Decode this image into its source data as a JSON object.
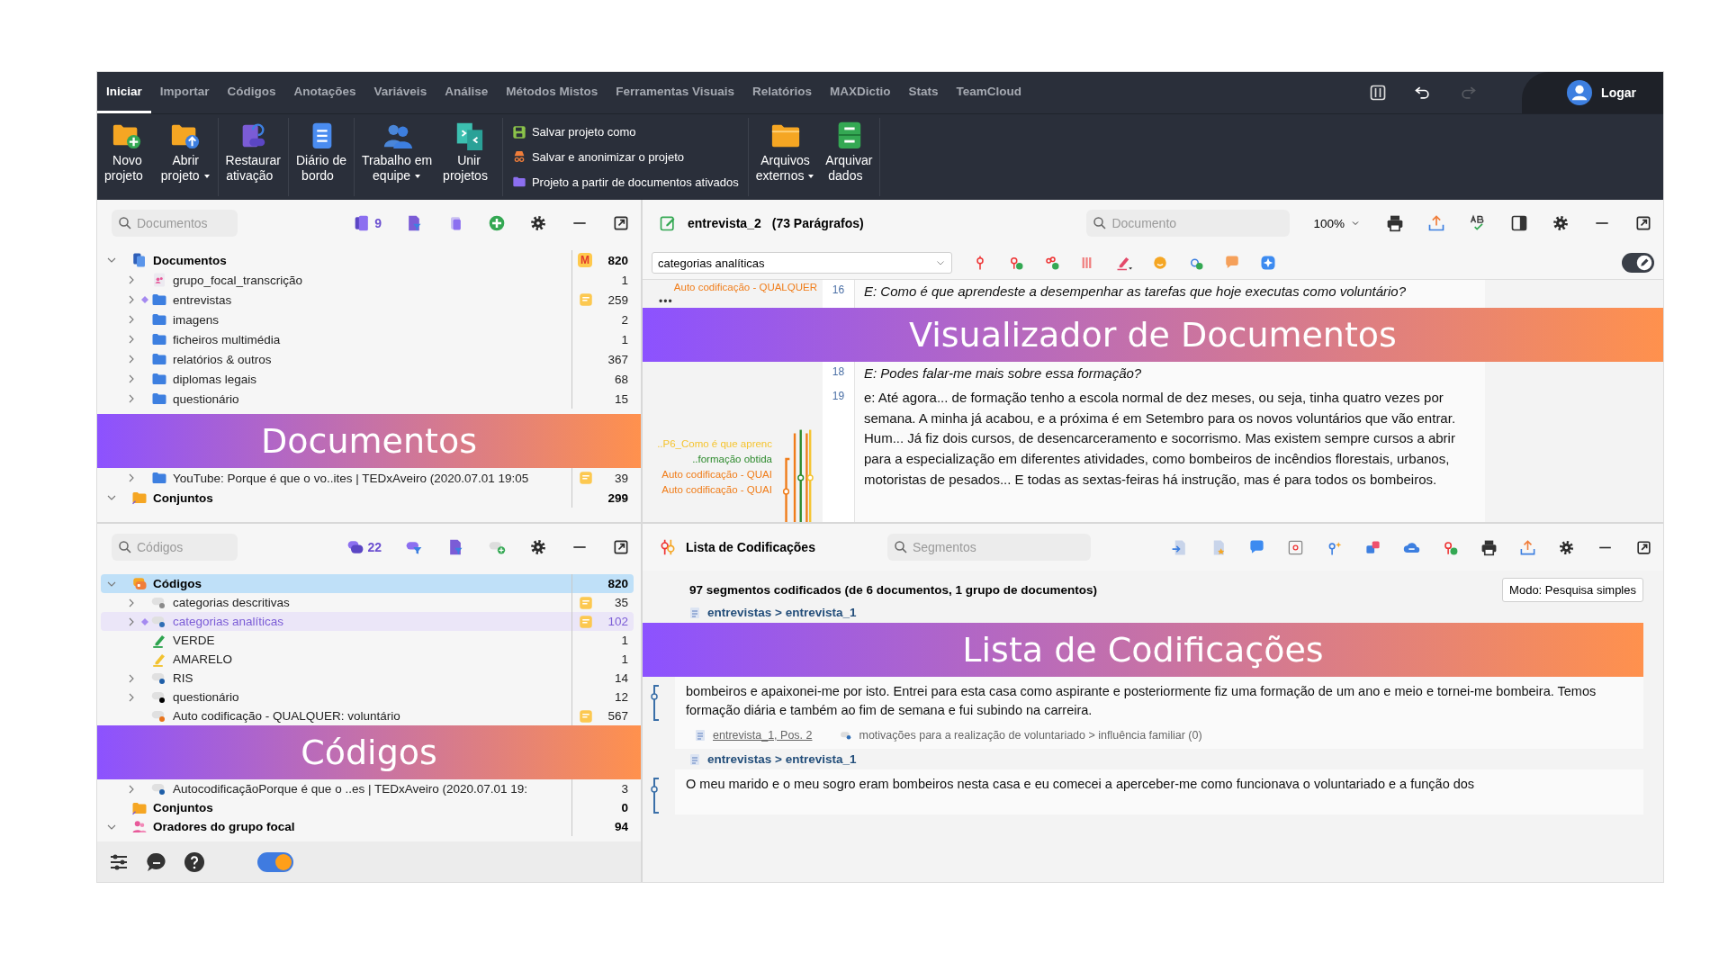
{
  "menu": {
    "tabs": [
      {
        "label": "Iniciar",
        "selected": true
      },
      {
        "label": "Importar",
        "selected": false
      },
      {
        "label": "Códigos",
        "selected": false
      },
      {
        "label": "Anotações",
        "selected": false
      },
      {
        "label": "Variáveis",
        "selected": false
      },
      {
        "label": "Análise",
        "selected": false
      },
      {
        "label": "Métodos Mistos",
        "selected": false
      },
      {
        "label": "Ferramentas Visuais",
        "selected": false
      },
      {
        "label": "Relatórios",
        "selected": false
      },
      {
        "label": "MAXDictio",
        "selected": false
      },
      {
        "label": "Stats",
        "selected": false
      },
      {
        "label": "TeamCloud",
        "selected": false
      }
    ],
    "redo_disabled": true,
    "login": "Logar"
  },
  "ribbon": [
    {
      "kind": "buttons",
      "items": [
        {
          "label": "Novo\nprojeto",
          "dropdown": false
        },
        {
          "label": "Abrir\nprojeto",
          "dropdown": true
        }
      ]
    },
    {
      "kind": "buttons",
      "items": [
        {
          "label": "Restaurar\nativação",
          "dropdown": false
        }
      ]
    },
    {
      "kind": "buttons",
      "items": [
        {
          "label": "Diário de\nbordo",
          "dropdown": false
        }
      ]
    },
    {
      "kind": "buttons",
      "items": [
        {
          "label": "Trabalho em\nequipe",
          "dropdown": true
        },
        {
          "label": "Unir\nprojetos",
          "dropdown": false
        }
      ]
    },
    {
      "kind": "links",
      "items": [
        {
          "label": "Salvar projeto como"
        },
        {
          "label": "Salvar e anonimizar o projeto"
        },
        {
          "label": "Projeto a partir de documentos ativados"
        }
      ]
    },
    {
      "kind": "buttons",
      "items": [
        {
          "label": "Arquivos\nexternos",
          "dropdown": true
        },
        {
          "label": "Arquivar\ndados",
          "dropdown": false
        }
      ]
    }
  ],
  "docs_panel": {
    "search": {
      "placeholder": "Documentos"
    },
    "counter": "9",
    "tree": [
      {
        "kind": "root-docs",
        "label": "Documentos",
        "expandable": true,
        "expanded": true,
        "selected": false,
        "activated": false,
        "memo": false,
        "badge": "M",
        "count": "820",
        "children": [
          {
            "kind": "focus-group",
            "label": "grupo_focal_transcrição",
            "expandable": true,
            "expanded": false,
            "selected": false,
            "activated": false,
            "memo": false,
            "count": "1"
          },
          {
            "kind": "folder",
            "label": "entrevistas",
            "expandable": true,
            "expanded": false,
            "selected": false,
            "activated": true,
            "memo": true,
            "count": "259"
          },
          {
            "kind": "folder",
            "label": "imagens",
            "expandable": true,
            "expanded": false,
            "selected": false,
            "activated": false,
            "memo": false,
            "count": "2"
          },
          {
            "kind": "folder",
            "label": "ficheiros multimédia",
            "expandable": true,
            "expanded": false,
            "selected": false,
            "activated": false,
            "memo": false,
            "count": "1"
          },
          {
            "kind": "folder",
            "label": "relatórios & outros",
            "expandable": true,
            "expanded": false,
            "selected": false,
            "activated": false,
            "memo": false,
            "count": "367"
          },
          {
            "kind": "folder",
            "label": "diplomas legais",
            "expandable": true,
            "expanded": false,
            "selected": false,
            "activated": false,
            "memo": false,
            "count": "68"
          },
          {
            "kind": "folder",
            "label": "questionário",
            "expandable": true,
            "expanded": false,
            "selected": false,
            "activated": false,
            "memo": false,
            "count": "15"
          },
          {
            "kind": "banner",
            "label": "Documentos"
          },
          {
            "kind": "folder",
            "label": "YouTube: Porque é que o vo..ites | TEDxAveiro (2020.07.01 19:05",
            "expandable": true,
            "expanded": false,
            "selected": false,
            "activated": false,
            "memo": true,
            "count": "39"
          }
        ]
      },
      {
        "kind": "set",
        "label": "Conjuntos",
        "expandable": true,
        "expanded": true,
        "selected": false,
        "activated": false,
        "memo": false,
        "count": "299"
      }
    ]
  },
  "codes_panel": {
    "search": {
      "placeholder": "Códigos"
    },
    "counter": "22",
    "tree": [
      {
        "kind": "root-codes",
        "label": "Códigos",
        "expandable": true,
        "expanded": true,
        "selected": true,
        "activated": false,
        "memo": false,
        "count": "820",
        "children": [
          {
            "kind": "code",
            "color": "#8a8a8a",
            "label": "categorias descritivas",
            "expandable": true,
            "expanded": false,
            "selected": false,
            "activated": false,
            "memo": true,
            "count": "35"
          },
          {
            "kind": "code",
            "color": "#2f6db5",
            "label": "categorias analíticas",
            "expandable": true,
            "expanded": false,
            "selected": false,
            "activated": true,
            "memo": true,
            "count": "102"
          },
          {
            "kind": "highlighter",
            "color": "#2ea44f",
            "label": "VERDE",
            "expandable": false,
            "expanded": false,
            "selected": false,
            "activated": false,
            "memo": false,
            "count": "1"
          },
          {
            "kind": "highlighter",
            "color": "#f2c230",
            "label": "AMARELO",
            "expandable": false,
            "expanded": false,
            "selected": false,
            "activated": false,
            "memo": false,
            "count": "1"
          },
          {
            "kind": "code",
            "color": "#1f5fa8",
            "label": "RIS",
            "expandable": true,
            "expanded": false,
            "selected": false,
            "activated": false,
            "memo": false,
            "count": "14"
          },
          {
            "kind": "code",
            "color": "#000000",
            "label": "questionário",
            "expandable": true,
            "expanded": false,
            "selected": false,
            "activated": false,
            "memo": false,
            "count": "12"
          },
          {
            "kind": "code",
            "color": "#e8741c",
            "label": "Auto codificação - QUALQUER: voluntário",
            "expandable": false,
            "expanded": false,
            "selected": false,
            "activated": false,
            "memo": true,
            "count": "567"
          },
          {
            "kind": "banner",
            "label": "Códigos"
          },
          {
            "kind": "code",
            "color": "#1f5fa8",
            "label": "AutocodificaçãoPorque é que o ..es | TEDxAveiro (2020.07.01 19:",
            "expandable": true,
            "expanded": false,
            "selected": false,
            "activated": false,
            "memo": false,
            "count": "3"
          }
        ]
      },
      {
        "kind": "set",
        "label": "Conjuntos",
        "expandable": false,
        "expanded": false,
        "selected": false,
        "activated": false,
        "memo": false,
        "count": "0"
      },
      {
        "kind": "speakers",
        "label": "Oradores do grupo focal",
        "expandable": true,
        "expanded": true,
        "selected": false,
        "activated": false,
        "memo": false,
        "count": "94"
      }
    ]
  },
  "footer": {
    "toggle_on": true
  },
  "doc_viewer": {
    "title": "entrevista_2",
    "paragraphs": "(73 Parágrafos)",
    "search": {
      "placeholder": "Documento"
    },
    "zoom": "100%",
    "code_select": "categorias analíticas",
    "edit_mode": true,
    "lines": [
      {
        "kind": "question",
        "number": "16",
        "text": "E: Como é que aprendeste a desempenhar as tarefas que hoje executas como voluntário?",
        "more": "•••",
        "margin": [
          {
            "label": "Auto codificação - QUALQUER",
            "color": "#f07d1a"
          }
        ]
      },
      {
        "kind": "banner",
        "label": "Visualizador de Documentos"
      },
      {
        "kind": "question",
        "number": "18",
        "text": "E: Podes falar-me mais sobre essa formação?"
      },
      {
        "kind": "answer",
        "number": "19",
        "text": "e: Até agora... de formação tenho a escola normal de dez meses, ou seja, tinha quatro vezes por semana. A minha já acabou, e a próxima é em Setembro para os novos voluntários que vão entrar. Hum... Já fiz dois cursos, de desencarceramento e socorrismo. Mas existem sempre cursos a abrir para a especialização em diferentes atividades, como bombeiros de incêndios florestais, urbanos, motoristas de pesados... E todas as sextas-feiras há instrução, mas é para todos os bombeiros.",
        "margin": [
          {
            "label": "..P6_Como é que aprenc",
            "color": "#f5c431"
          },
          {
            "label": "..formação obtida",
            "color": "#2e8b2e"
          },
          {
            "label": "Auto codificação - QUAI",
            "color": "#f07d1a"
          },
          {
            "label": "Auto codificação - QUAI",
            "color": "#f07d1a"
          }
        ]
      }
    ]
  },
  "coding_list": {
    "title": "Lista de Codificações",
    "search": {
      "placeholder": "Segmentos"
    },
    "summary": "97 segmentos codificados (de 6 documentos, 1 grupo de documentos)",
    "mode": "Modo: Pesquisa simples",
    "items": [
      {
        "kind": "source",
        "label": "entrevistas > entrevista_1"
      },
      {
        "kind": "banner",
        "label": "Lista de Codificações"
      },
      {
        "kind": "segment",
        "text": "bombeiros e apaixonei-me por isto. Entrei para esta casa como aspirante e posteriormente fiz uma formação de um ano e meio e tornei-me bombeira. Temos formação diária e também ao fim de semana e fui subindo na carreira.",
        "reference": "entrevista_1, Pos. 2",
        "code": "motivações para a realização de voluntariado > influência familiar (0)"
      },
      {
        "kind": "source",
        "label": "entrevistas > entrevista_1"
      },
      {
        "kind": "segment",
        "text": "O meu marido e o meu sogro eram bombeiros nesta casa e eu comecei a aperceber-me como funcionava o voluntariado e a função dos"
      }
    ]
  }
}
